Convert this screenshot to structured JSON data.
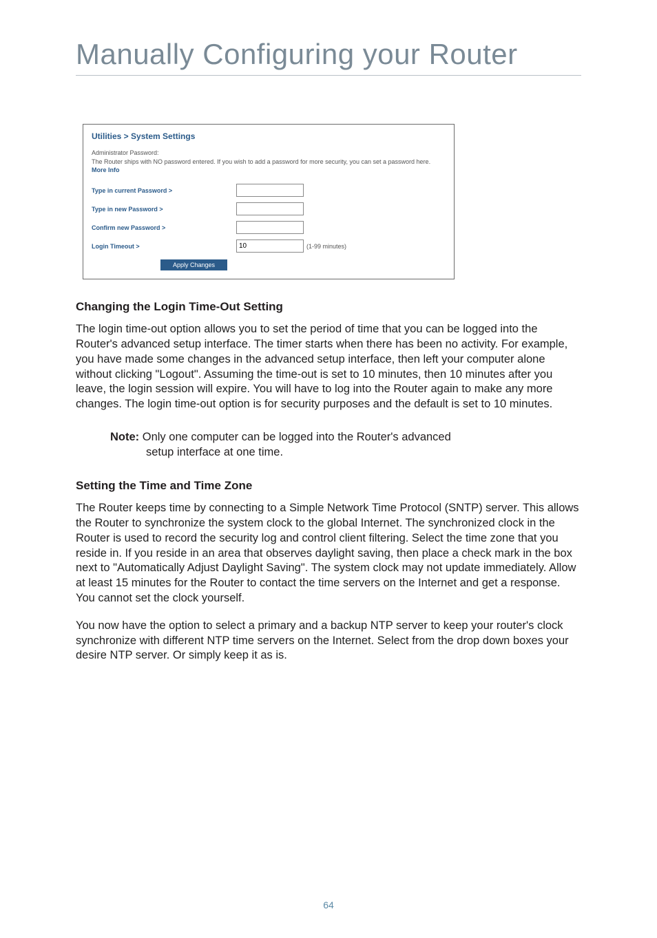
{
  "page": {
    "title": "Manually Configuring your Router",
    "number": "64"
  },
  "router_panel": {
    "title": "Utilities > System Settings",
    "admin_header": "Administrator Password:",
    "admin_desc_prefix": "The Router ships with NO password entered. If you wish to add a password for more security, you can set a password here. ",
    "more_info": "More Info",
    "rows": {
      "current_pw_label": "Type in current Password >",
      "new_pw_label": "Type in new Password >",
      "confirm_pw_label": "Confirm new Password >",
      "timeout_label": "Login Timeout >",
      "timeout_value": "10",
      "timeout_suffix": "(1-99 minutes)"
    },
    "apply_label": "Apply Changes"
  },
  "sections": {
    "s1_heading": "Changing the Login Time-Out Setting",
    "s1_para": "The login time-out option allows you to set the period of time that you can be logged into the Router's advanced setup interface. The timer starts when there has been no activity. For example, you have made some changes in the advanced setup interface, then left your computer alone without clicking \"Logout\". Assuming the time-out is set to 10 minutes, then 10 minutes after you leave, the login session will expire. You will have to log into the Router again to make any more changes. The login time-out option is for security purposes and the default is set to 10 minutes.",
    "note_label": "Note:",
    "note_text_l1": " Only one computer can be logged into the Router's advanced",
    "note_text_l2": "setup interface at one time.",
    "s2_heading": "Setting the Time and Time Zone",
    "s2_para1": "The Router keeps time by connecting to a Simple Network Time Protocol (SNTP) server. This allows the Router to synchronize the system clock to the global Internet. The synchronized clock in the Router is used to record the security log and control client filtering. Select the time zone that you reside in. If you reside in an area that observes daylight saving, then place a check mark in the box next to \"Automatically Adjust Daylight Saving\". The system clock may not update immediately. Allow at least 15 minutes for the Router to contact the time servers on the Internet and get a response. You cannot set the clock yourself.",
    "s2_para2": "You now have the option to select a primary and a backup NTP server to keep your router's clock synchronize with different NTP time servers on the Internet. Select from the drop down boxes your desire NTP server. Or simply keep it as is."
  }
}
